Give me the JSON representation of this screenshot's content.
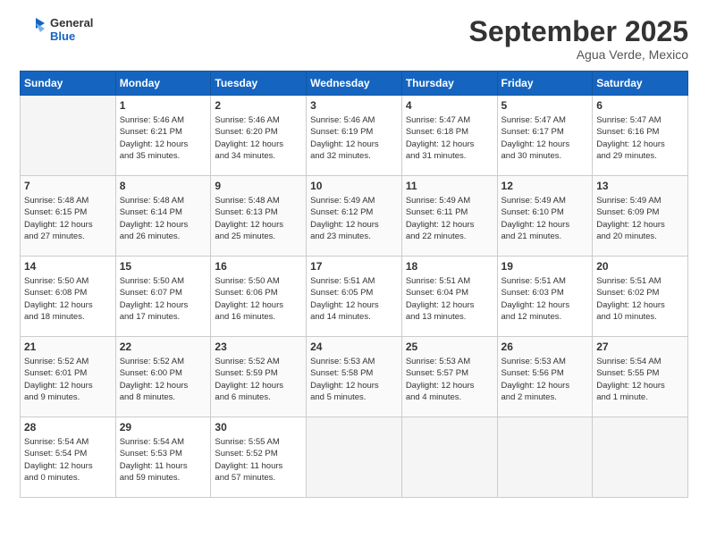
{
  "header": {
    "logo_general": "General",
    "logo_blue": "Blue",
    "month": "September 2025",
    "location": "Agua Verde, Mexico"
  },
  "weekdays": [
    "Sunday",
    "Monday",
    "Tuesday",
    "Wednesday",
    "Thursday",
    "Friday",
    "Saturday"
  ],
  "weeks": [
    [
      {
        "day": "",
        "info": ""
      },
      {
        "day": "1",
        "info": "Sunrise: 5:46 AM\nSunset: 6:21 PM\nDaylight: 12 hours\nand 35 minutes."
      },
      {
        "day": "2",
        "info": "Sunrise: 5:46 AM\nSunset: 6:20 PM\nDaylight: 12 hours\nand 34 minutes."
      },
      {
        "day": "3",
        "info": "Sunrise: 5:46 AM\nSunset: 6:19 PM\nDaylight: 12 hours\nand 32 minutes."
      },
      {
        "day": "4",
        "info": "Sunrise: 5:47 AM\nSunset: 6:18 PM\nDaylight: 12 hours\nand 31 minutes."
      },
      {
        "day": "5",
        "info": "Sunrise: 5:47 AM\nSunset: 6:17 PM\nDaylight: 12 hours\nand 30 minutes."
      },
      {
        "day": "6",
        "info": "Sunrise: 5:47 AM\nSunset: 6:16 PM\nDaylight: 12 hours\nand 29 minutes."
      }
    ],
    [
      {
        "day": "7",
        "info": "Sunrise: 5:48 AM\nSunset: 6:15 PM\nDaylight: 12 hours\nand 27 minutes."
      },
      {
        "day": "8",
        "info": "Sunrise: 5:48 AM\nSunset: 6:14 PM\nDaylight: 12 hours\nand 26 minutes."
      },
      {
        "day": "9",
        "info": "Sunrise: 5:48 AM\nSunset: 6:13 PM\nDaylight: 12 hours\nand 25 minutes."
      },
      {
        "day": "10",
        "info": "Sunrise: 5:49 AM\nSunset: 6:12 PM\nDaylight: 12 hours\nand 23 minutes."
      },
      {
        "day": "11",
        "info": "Sunrise: 5:49 AM\nSunset: 6:11 PM\nDaylight: 12 hours\nand 22 minutes."
      },
      {
        "day": "12",
        "info": "Sunrise: 5:49 AM\nSunset: 6:10 PM\nDaylight: 12 hours\nand 21 minutes."
      },
      {
        "day": "13",
        "info": "Sunrise: 5:49 AM\nSunset: 6:09 PM\nDaylight: 12 hours\nand 20 minutes."
      }
    ],
    [
      {
        "day": "14",
        "info": "Sunrise: 5:50 AM\nSunset: 6:08 PM\nDaylight: 12 hours\nand 18 minutes."
      },
      {
        "day": "15",
        "info": "Sunrise: 5:50 AM\nSunset: 6:07 PM\nDaylight: 12 hours\nand 17 minutes."
      },
      {
        "day": "16",
        "info": "Sunrise: 5:50 AM\nSunset: 6:06 PM\nDaylight: 12 hours\nand 16 minutes."
      },
      {
        "day": "17",
        "info": "Sunrise: 5:51 AM\nSunset: 6:05 PM\nDaylight: 12 hours\nand 14 minutes."
      },
      {
        "day": "18",
        "info": "Sunrise: 5:51 AM\nSunset: 6:04 PM\nDaylight: 12 hours\nand 13 minutes."
      },
      {
        "day": "19",
        "info": "Sunrise: 5:51 AM\nSunset: 6:03 PM\nDaylight: 12 hours\nand 12 minutes."
      },
      {
        "day": "20",
        "info": "Sunrise: 5:51 AM\nSunset: 6:02 PM\nDaylight: 12 hours\nand 10 minutes."
      }
    ],
    [
      {
        "day": "21",
        "info": "Sunrise: 5:52 AM\nSunset: 6:01 PM\nDaylight: 12 hours\nand 9 minutes."
      },
      {
        "day": "22",
        "info": "Sunrise: 5:52 AM\nSunset: 6:00 PM\nDaylight: 12 hours\nand 8 minutes."
      },
      {
        "day": "23",
        "info": "Sunrise: 5:52 AM\nSunset: 5:59 PM\nDaylight: 12 hours\nand 6 minutes."
      },
      {
        "day": "24",
        "info": "Sunrise: 5:53 AM\nSunset: 5:58 PM\nDaylight: 12 hours\nand 5 minutes."
      },
      {
        "day": "25",
        "info": "Sunrise: 5:53 AM\nSunset: 5:57 PM\nDaylight: 12 hours\nand 4 minutes."
      },
      {
        "day": "26",
        "info": "Sunrise: 5:53 AM\nSunset: 5:56 PM\nDaylight: 12 hours\nand 2 minutes."
      },
      {
        "day": "27",
        "info": "Sunrise: 5:54 AM\nSunset: 5:55 PM\nDaylight: 12 hours\nand 1 minute."
      }
    ],
    [
      {
        "day": "28",
        "info": "Sunrise: 5:54 AM\nSunset: 5:54 PM\nDaylight: 12 hours\nand 0 minutes."
      },
      {
        "day": "29",
        "info": "Sunrise: 5:54 AM\nSunset: 5:53 PM\nDaylight: 11 hours\nand 59 minutes."
      },
      {
        "day": "30",
        "info": "Sunrise: 5:55 AM\nSunset: 5:52 PM\nDaylight: 11 hours\nand 57 minutes."
      },
      {
        "day": "",
        "info": ""
      },
      {
        "day": "",
        "info": ""
      },
      {
        "day": "",
        "info": ""
      },
      {
        "day": "",
        "info": ""
      }
    ]
  ]
}
